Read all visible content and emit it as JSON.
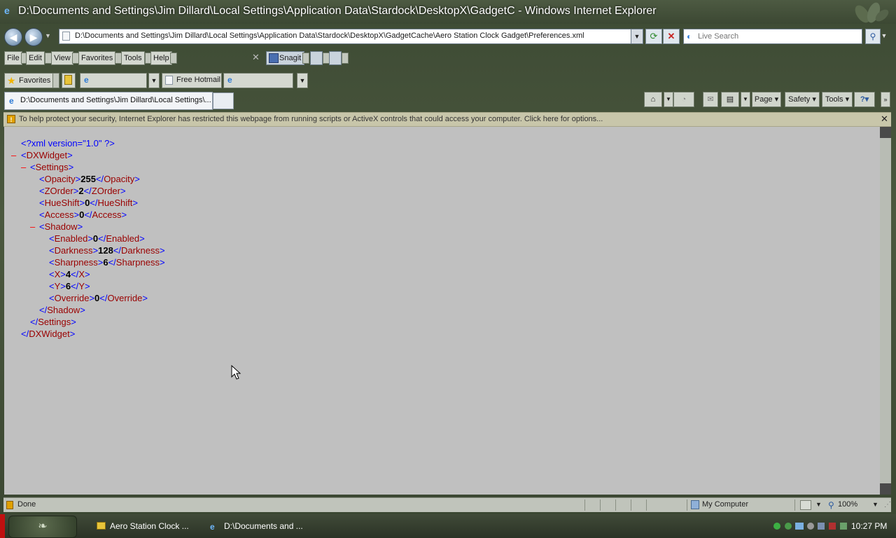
{
  "window": {
    "title": "D:\\Documents and Settings\\Jim Dillard\\Local Settings\\Application Data\\Stardock\\DesktopX\\GadgetC - Windows Internet Explorer"
  },
  "address_bar": {
    "url": "D:\\Documents and Settings\\Jim Dillard\\Local Settings\\Application Data\\Stardock\\DesktopX\\GadgetCache\\Aero Station Clock Gadget\\Preferences.xml"
  },
  "search": {
    "placeholder": "Live Search"
  },
  "menu": {
    "file": "File",
    "edit": "Edit",
    "view": "View",
    "favorites": "Favorites",
    "tools": "Tools",
    "help": "Help",
    "snagit": "Snagit"
  },
  "favorites_bar": {
    "favorites_label": "Favorites",
    "hotmail_label": "Free Hotmail"
  },
  "tab": {
    "label": "D:\\Documents and Settings\\Jim Dillard\\Local Settings\\..."
  },
  "command_bar": {
    "page": "Page",
    "safety": "Safety",
    "tools": "Tools"
  },
  "info_bar": {
    "text": "To help protect your security, Internet Explorer has restricted this webpage from running scripts or ActiveX controls that could access your computer. Click here for options..."
  },
  "xml": {
    "declaration": "<?xml version=\"1.0\" ?>",
    "root": "DXWidget",
    "settings": "Settings",
    "shadow": "Shadow",
    "settings_items": [
      {
        "tag": "Opacity",
        "value": "255"
      },
      {
        "tag": "ZOrder",
        "value": "2"
      },
      {
        "tag": "HueShift",
        "value": "0"
      },
      {
        "tag": "Access",
        "value": "0"
      }
    ],
    "shadow_items": [
      {
        "tag": "Enabled",
        "value": "0"
      },
      {
        "tag": "Darkness",
        "value": "128"
      },
      {
        "tag": "Sharpness",
        "value": "6"
      },
      {
        "tag": "X",
        "value": "4"
      },
      {
        "tag": "Y",
        "value": "6"
      },
      {
        "tag": "Override",
        "value": "0"
      }
    ]
  },
  "status_bar": {
    "status": "Done",
    "zone": "My Computer",
    "zoom": "100%"
  },
  "taskbar": {
    "items": [
      {
        "label": "Aero Station Clock ..."
      },
      {
        "label": "D:\\Documents and ..."
      }
    ],
    "clock": "10:27 PM"
  }
}
